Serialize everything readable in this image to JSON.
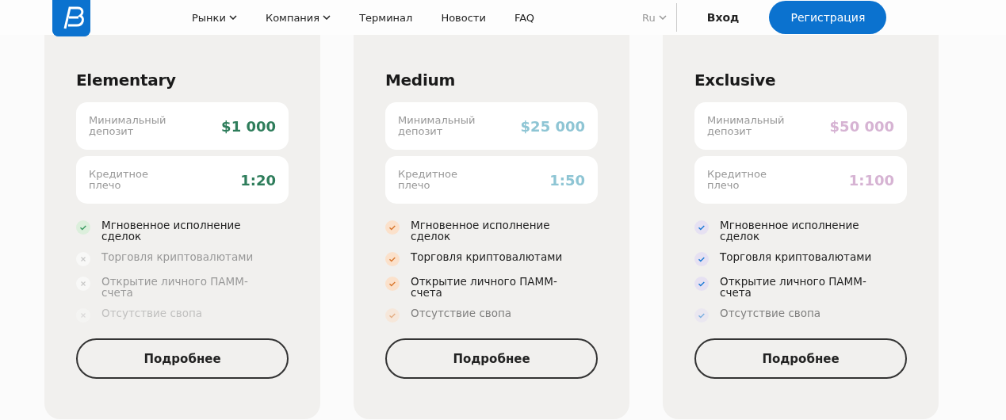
{
  "header": {
    "nav": [
      {
        "label": "Рынки",
        "dropdown": true
      },
      {
        "label": "Компания",
        "dropdown": true
      },
      {
        "label": "Терминал",
        "dropdown": false
      },
      {
        "label": "Новости",
        "dropdown": false
      },
      {
        "label": "FAQ",
        "dropdown": false
      }
    ],
    "language": "Ru",
    "login": "Вход",
    "register": "Регистрация"
  },
  "plans": [
    {
      "name": "Elementary",
      "specs": [
        {
          "label": "Минимальный депозит",
          "value": "$1 000"
        },
        {
          "label": "Кредитное плечо",
          "value": "1:20"
        }
      ],
      "features": [
        {
          "label": "Мгновенное исполнение сделок",
          "included": true
        },
        {
          "label": "Торговля криптовалютами",
          "included": false
        },
        {
          "label": "Открытие личного ПАММ-счета",
          "included": false
        },
        {
          "label": "Отсутствие свопа",
          "included": false
        }
      ],
      "button": "Подробнее"
    },
    {
      "name": "Medium",
      "specs": [
        {
          "label": "Минимальный депозит",
          "value": "$25 000"
        },
        {
          "label": "Кредитное плечо",
          "value": "1:50"
        }
      ],
      "features": [
        {
          "label": "Мгновенное исполнение сделок",
          "included": true
        },
        {
          "label": "Торговля криптовалютами",
          "included": true
        },
        {
          "label": "Открытие личного ПАММ-счета",
          "included": true
        },
        {
          "label": "Отсутствие свопа",
          "included": true
        }
      ],
      "button": "Подробнее"
    },
    {
      "name": "Exclusive",
      "specs": [
        {
          "label": "Минимальный депозит",
          "value": "$50 000"
        },
        {
          "label": "Кредитное плечо",
          "value": "1:100"
        }
      ],
      "features": [
        {
          "label": "Мгновенное исполнение сделок",
          "included": true
        },
        {
          "label": "Торговля криптовалютами",
          "included": true
        },
        {
          "label": "Открытие личного ПАММ-счета",
          "included": true
        },
        {
          "label": "Отсутствие свопа",
          "included": true
        }
      ],
      "button": "Подробнее"
    }
  ]
}
